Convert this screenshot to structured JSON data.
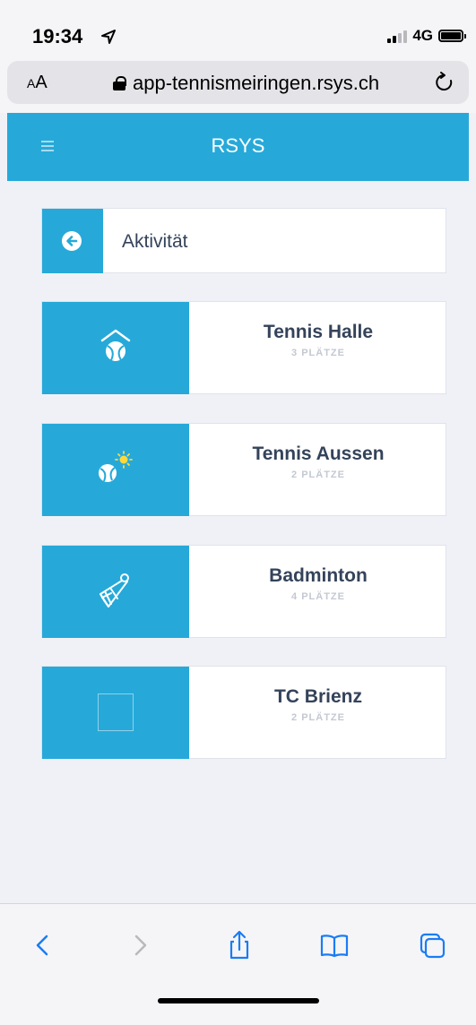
{
  "status_bar": {
    "time": "19:34",
    "network": "4G"
  },
  "url_bar": {
    "aa_label_small": "A",
    "aa_label_large": "A",
    "url": "app-tennismeiringen.rsys.ch"
  },
  "header": {
    "title": "RSYS"
  },
  "back_card": {
    "label": "Aktivität",
    "icon": "arrow-left-circle-icon"
  },
  "activities": [
    {
      "name": "Tennis Halle",
      "subtitle": "3 PLÄTZE",
      "icon": "tennis-hall-icon"
    },
    {
      "name": "Tennis Aussen",
      "subtitle": "2 PLÄTZE",
      "icon": "tennis-sun-icon"
    },
    {
      "name": "Badminton",
      "subtitle": "4 PLÄTZE",
      "icon": "shuttlecock-icon"
    },
    {
      "name": "TC Brienz",
      "subtitle": "2 PLÄTZE",
      "icon": "placeholder-square-icon"
    }
  ],
  "colors": {
    "accent": "#26a9d9",
    "card_text": "#34435a",
    "subtitle": "#c3c8d2",
    "ios_blue": "#1a7cf5"
  }
}
